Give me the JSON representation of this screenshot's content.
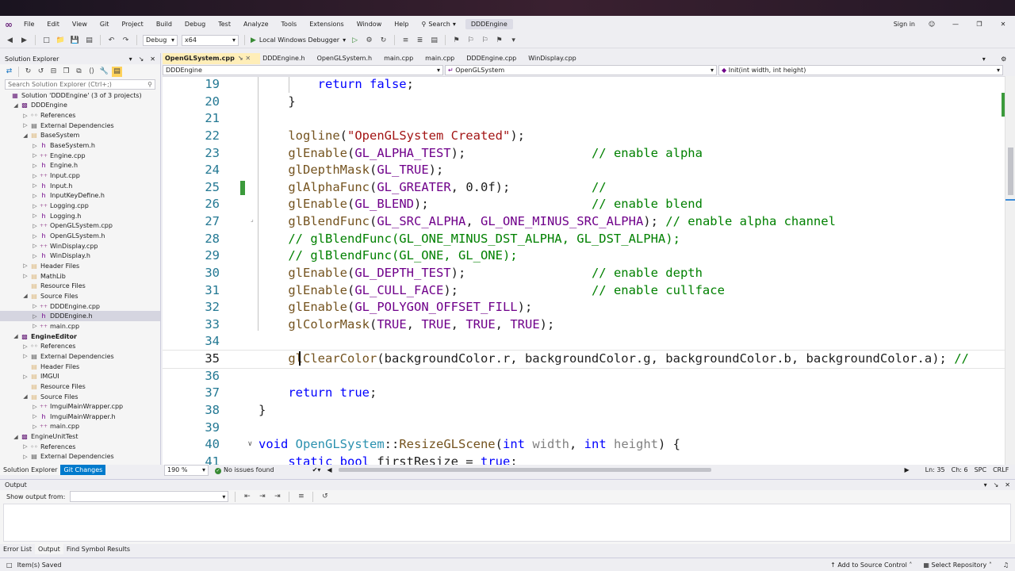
{
  "menu": {
    "items": [
      "File",
      "Edit",
      "View",
      "Git",
      "Project",
      "Build",
      "Debug",
      "Test",
      "Analyze",
      "Tools",
      "Extensions",
      "Window",
      "Help"
    ],
    "search_label": "Search",
    "solution_name": "DDDEngine",
    "sign_in": "Sign in"
  },
  "toolbar": {
    "config": "Debug",
    "platform": "x64",
    "debugger": "Local Windows Debugger"
  },
  "solution_explorer": {
    "title": "Solution Explorer",
    "search_placeholder": "Search Solution Explorer (Ctrl+;)",
    "tree": [
      {
        "label": "Solution 'DDDEngine' (3 of 3 projects)",
        "depth": 0,
        "arrow": "",
        "icon": "sln"
      },
      {
        "label": "DDDEngine",
        "depth": 1,
        "arrow": "down",
        "icon": "proj"
      },
      {
        "label": "References",
        "depth": 2,
        "arrow": "right",
        "icon": "ref"
      },
      {
        "label": "External Dependencies",
        "depth": 2,
        "arrow": "right",
        "icon": "ext"
      },
      {
        "label": "BaseSystem",
        "depth": 2,
        "arrow": "down",
        "icon": "folder"
      },
      {
        "label": "BaseSystem.h",
        "depth": 3,
        "arrow": "right",
        "icon": "h"
      },
      {
        "label": "Engine.cpp",
        "depth": 3,
        "arrow": "right",
        "icon": "cpp"
      },
      {
        "label": "Engine.h",
        "depth": 3,
        "arrow": "right",
        "icon": "h"
      },
      {
        "label": "Input.cpp",
        "depth": 3,
        "arrow": "right",
        "icon": "cpp"
      },
      {
        "label": "Input.h",
        "depth": 3,
        "arrow": "right",
        "icon": "h"
      },
      {
        "label": "InputKeyDefine.h",
        "depth": 3,
        "arrow": "right",
        "icon": "h"
      },
      {
        "label": "Logging.cpp",
        "depth": 3,
        "arrow": "right",
        "icon": "cpp"
      },
      {
        "label": "Logging.h",
        "depth": 3,
        "arrow": "right",
        "icon": "h"
      },
      {
        "label": "OpenGLSystem.cpp",
        "depth": 3,
        "arrow": "right",
        "icon": "cpp"
      },
      {
        "label": "OpenGLSystem.h",
        "depth": 3,
        "arrow": "right",
        "icon": "h"
      },
      {
        "label": "WinDisplay.cpp",
        "depth": 3,
        "arrow": "right",
        "icon": "cpp"
      },
      {
        "label": "WinDisplay.h",
        "depth": 3,
        "arrow": "right",
        "icon": "h"
      },
      {
        "label": "Header Files",
        "depth": 2,
        "arrow": "right",
        "icon": "folder"
      },
      {
        "label": "MathLib",
        "depth": 2,
        "arrow": "right",
        "icon": "folder"
      },
      {
        "label": "Resource Files",
        "depth": 2,
        "arrow": "",
        "icon": "folder"
      },
      {
        "label": "Source Files",
        "depth": 2,
        "arrow": "down",
        "icon": "folder"
      },
      {
        "label": "DDDEngine.cpp",
        "depth": 3,
        "arrow": "right",
        "icon": "cpp"
      },
      {
        "label": "DDDEngine.h",
        "depth": 3,
        "arrow": "right",
        "icon": "h",
        "selected": true
      },
      {
        "label": "main.cpp",
        "depth": 3,
        "arrow": "right",
        "icon": "cpp"
      },
      {
        "label": "EngineEditor",
        "depth": 1,
        "arrow": "down",
        "icon": "proj",
        "bold": true
      },
      {
        "label": "References",
        "depth": 2,
        "arrow": "right",
        "icon": "ref"
      },
      {
        "label": "External Dependencies",
        "depth": 2,
        "arrow": "right",
        "icon": "ext"
      },
      {
        "label": "Header Files",
        "depth": 2,
        "arrow": "",
        "icon": "folder"
      },
      {
        "label": "IMGUI",
        "depth": 2,
        "arrow": "right",
        "icon": "folder"
      },
      {
        "label": "Resource Files",
        "depth": 2,
        "arrow": "",
        "icon": "folder"
      },
      {
        "label": "Source Files",
        "depth": 2,
        "arrow": "down",
        "icon": "folder"
      },
      {
        "label": "ImguiMainWrapper.cpp",
        "depth": 3,
        "arrow": "right",
        "icon": "cpp"
      },
      {
        "label": "ImguiMainWrapper.h",
        "depth": 3,
        "arrow": "right",
        "icon": "h"
      },
      {
        "label": "main.cpp",
        "depth": 3,
        "arrow": "right",
        "icon": "cpp"
      },
      {
        "label": "EngineUnitTest",
        "depth": 1,
        "arrow": "down",
        "icon": "proj"
      },
      {
        "label": "References",
        "depth": 2,
        "arrow": "right",
        "icon": "ref"
      },
      {
        "label": "External Dependencies",
        "depth": 2,
        "arrow": "right",
        "icon": "ext"
      }
    ],
    "tabs": [
      "Solution Explorer",
      "Git Changes"
    ]
  },
  "editor_tabs": [
    "OpenGLSystem.cpp",
    "DDDEngine.h",
    "OpenGLSystem.h",
    "main.cpp",
    "main.cpp",
    "DDDEngine.cpp",
    "WinDisplay.cpp"
  ],
  "navbar": {
    "project": "DDDEngine",
    "scope": "OpenGLSystem",
    "member": "Init(int width, int height)"
  },
  "code_lines": [
    {
      "n": "19",
      "t": [
        [
          "kw",
          "        return "
        ],
        [
          "kw",
          "false"
        ],
        [
          "txt",
          ";"
        ]
      ]
    },
    {
      "n": "20",
      "t": [
        [
          "txt",
          "    }"
        ]
      ]
    },
    {
      "n": "21",
      "t": []
    },
    {
      "n": "22",
      "t": [
        [
          "fn",
          "    logline"
        ],
        [
          "txt",
          "("
        ],
        [
          "str",
          "\"OpenGLSystem Created\""
        ],
        [
          "txt",
          ");"
        ]
      ]
    },
    {
      "n": "23",
      "t": [
        [
          "fn",
          "    glEnable"
        ],
        [
          "txt",
          "("
        ],
        [
          "mac",
          "GL_ALPHA_TEST"
        ],
        [
          "txt",
          ");                 "
        ],
        [
          "cmt",
          "// enable alpha"
        ]
      ]
    },
    {
      "n": "24",
      "t": [
        [
          "fn",
          "    glDepthMask"
        ],
        [
          "txt",
          "("
        ],
        [
          "mac",
          "GL_TRUE"
        ],
        [
          "txt",
          ");"
        ]
      ]
    },
    {
      "n": "25",
      "t": [
        [
          "fn",
          "    glAlphaFunc"
        ],
        [
          "txt",
          "("
        ],
        [
          "mac",
          "GL_GREATER"
        ],
        [
          "txt",
          ", 0.0f);           "
        ],
        [
          "cmt",
          "//"
        ]
      ]
    },
    {
      "n": "26",
      "t": [
        [
          "fn",
          "    glEnable"
        ],
        [
          "txt",
          "("
        ],
        [
          "mac",
          "GL_BLEND"
        ],
        [
          "txt",
          ");                      "
        ],
        [
          "cmt",
          "// enable blend"
        ]
      ]
    },
    {
      "n": "27",
      "t": [
        [
          "fn",
          "    glBlendFunc"
        ],
        [
          "txt",
          "("
        ],
        [
          "mac",
          "GL_SRC_ALPHA"
        ],
        [
          "txt",
          ", "
        ],
        [
          "mac",
          "GL_ONE_MINUS_SRC_ALPHA"
        ],
        [
          "txt",
          "); "
        ],
        [
          "cmt",
          "// enable alpha channel"
        ]
      ]
    },
    {
      "n": "28",
      "t": [
        [
          "cmt",
          "    // glBlendFunc(GL_ONE_MINUS_DST_ALPHA, GL_DST_ALPHA);"
        ]
      ]
    },
    {
      "n": "29",
      "t": [
        [
          "cmt",
          "    // glBlendFunc(GL_ONE, GL_ONE);"
        ]
      ]
    },
    {
      "n": "30",
      "t": [
        [
          "fn",
          "    glEnable"
        ],
        [
          "txt",
          "("
        ],
        [
          "mac",
          "GL_DEPTH_TEST"
        ],
        [
          "txt",
          ");                 "
        ],
        [
          "cmt",
          "// enable depth"
        ]
      ]
    },
    {
      "n": "31",
      "t": [
        [
          "fn",
          "    glEnable"
        ],
        [
          "txt",
          "("
        ],
        [
          "mac",
          "GL_CULL_FACE"
        ],
        [
          "txt",
          ");                  "
        ],
        [
          "cmt",
          "// enable cullface"
        ]
      ]
    },
    {
      "n": "32",
      "t": [
        [
          "fn",
          "    glEnable"
        ],
        [
          "txt",
          "("
        ],
        [
          "mac",
          "GL_POLYGON_OFFSET_FILL"
        ],
        [
          "txt",
          ");"
        ]
      ]
    },
    {
      "n": "33",
      "t": [
        [
          "fn",
          "    glColorMask"
        ],
        [
          "txt",
          "("
        ],
        [
          "mac",
          "TRUE"
        ],
        [
          "txt",
          ", "
        ],
        [
          "mac",
          "TRUE"
        ],
        [
          "txt",
          ", "
        ],
        [
          "mac",
          "TRUE"
        ],
        [
          "txt",
          ", "
        ],
        [
          "mac",
          "TRUE"
        ],
        [
          "txt",
          ");"
        ]
      ]
    },
    {
      "n": "34",
      "t": []
    },
    {
      "n": "35",
      "t": [
        [
          "fn",
          "    glClearColor"
        ],
        [
          "txt",
          "(backgroundColor.r, backgroundColor.g, backgroundColor.b, backgroundColor.a); "
        ],
        [
          "cmt",
          "//"
        ]
      ]
    },
    {
      "n": "36",
      "t": []
    },
    {
      "n": "37",
      "t": [
        [
          "kw",
          "    return "
        ],
        [
          "kw",
          "true"
        ],
        [
          "txt",
          ";"
        ]
      ]
    },
    {
      "n": "38",
      "t": [
        [
          "txt",
          "}"
        ]
      ]
    },
    {
      "n": "39",
      "t": []
    },
    {
      "n": "40",
      "t": [
        [
          "kw",
          "void "
        ],
        [
          "ty",
          "OpenGLSystem"
        ],
        [
          "txt",
          "::"
        ],
        [
          "fn",
          "ResizeGLScene"
        ],
        [
          "txt",
          "("
        ],
        [
          "kw",
          "int "
        ],
        [
          "par",
          "width"
        ],
        [
          "txt",
          ", "
        ],
        [
          "kw",
          "int "
        ],
        [
          "par",
          "height"
        ],
        [
          "txt",
          ") {"
        ]
      ]
    },
    {
      "n": "41",
      "t": [
        [
          "kw",
          "    static bool "
        ],
        [
          "txt",
          "firstResize = "
        ],
        [
          "kw",
          "true"
        ],
        [
          "txt",
          ";"
        ]
      ]
    }
  ],
  "editor_status": {
    "zoom": "190 %",
    "issues": "No issues found",
    "position": "Ln: 35",
    "col": "Ch: 6",
    "spc": "SPC",
    "crlf": "CRLF"
  },
  "output": {
    "title": "Output",
    "show_from": "Show output from:"
  },
  "bottom_tabs": [
    "Error List",
    "Output",
    "Find Symbol Results"
  ],
  "statusbar": {
    "left": "Item(s) Saved",
    "source_control": "Add to Source Control",
    "repo": "Select Repository"
  }
}
